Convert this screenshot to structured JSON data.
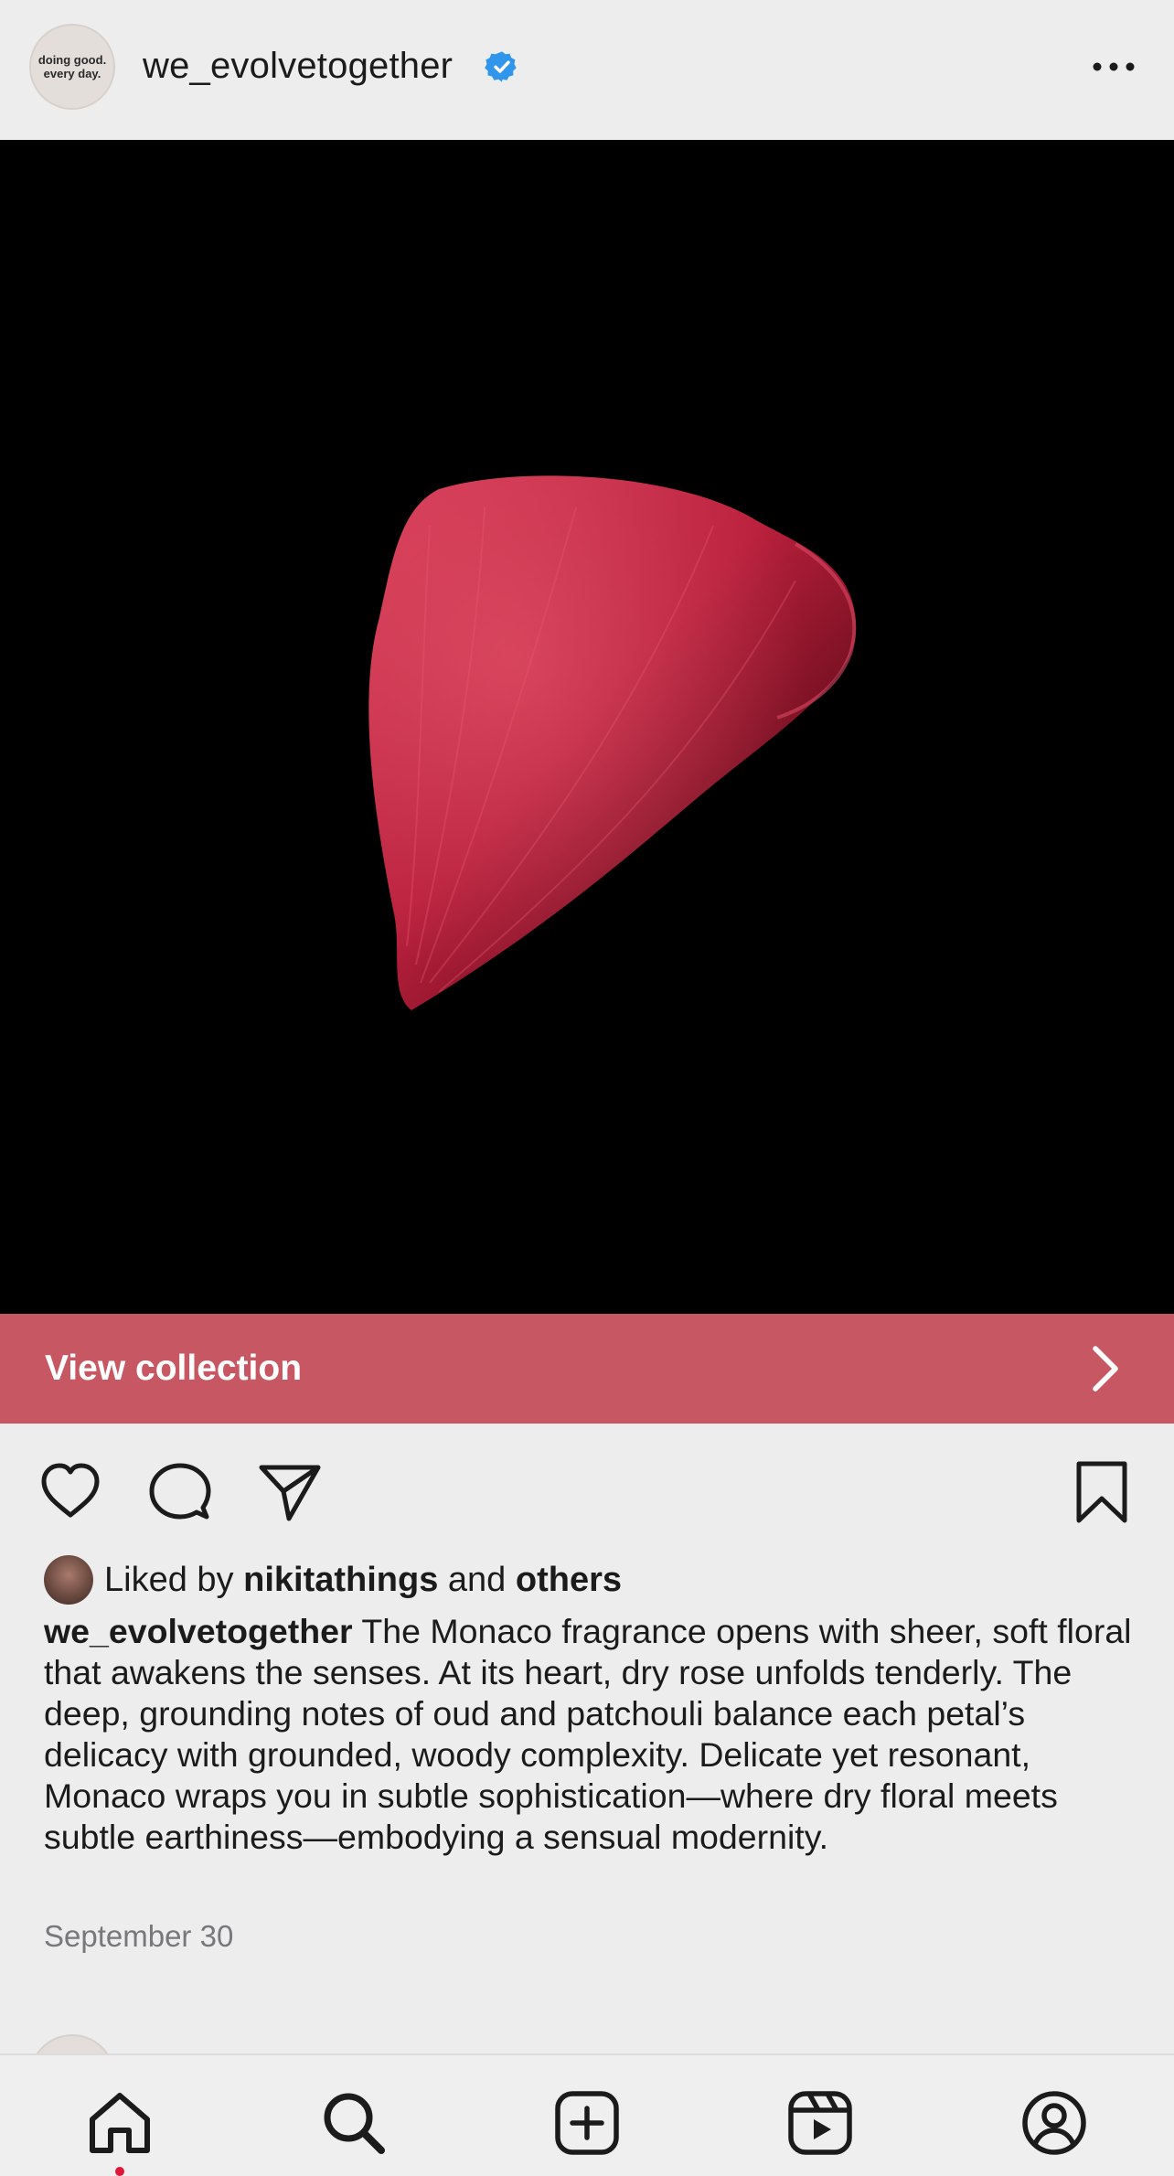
{
  "header": {
    "avatar_text_line1": "doing good.",
    "avatar_text_line2": "every day.",
    "username": "we_evolvetogether",
    "verified_icon": "verified-badge-icon",
    "more_icon": "more-horizontal-icon"
  },
  "post": {
    "image_subject": "rose-petal",
    "shop_icon": "shopping-bag-icon",
    "collection_label": "View collection",
    "collection_color": "#c85764"
  },
  "actions": {
    "like_icon": "heart-icon",
    "comment_icon": "comment-icon",
    "share_icon": "send-icon",
    "save_icon": "bookmark-icon"
  },
  "likes": {
    "prefix": "Liked by",
    "user": "nikitathings",
    "conjunction": "and",
    "others": "others"
  },
  "caption": {
    "username": "we_evolvetogether",
    "text": "The Monaco fragrance opens with sheer, soft floral that awakens the senses. At its heart, dry rose unfolds tenderly. The deep, grounding notes of oud and patchouli balance each petal’s delicacy with grounded, woody complexity. Delicate yet resonant, Monaco wraps you in subtle sophistication—where dry floral meets subtle earthiness—embodying a sensual modernity."
  },
  "date": "September 30",
  "tabbar": {
    "tabs": [
      "home-icon",
      "search-icon",
      "create-icon",
      "reels-icon",
      "profile-icon"
    ],
    "active": "home",
    "notification_color": "#e0163a"
  }
}
